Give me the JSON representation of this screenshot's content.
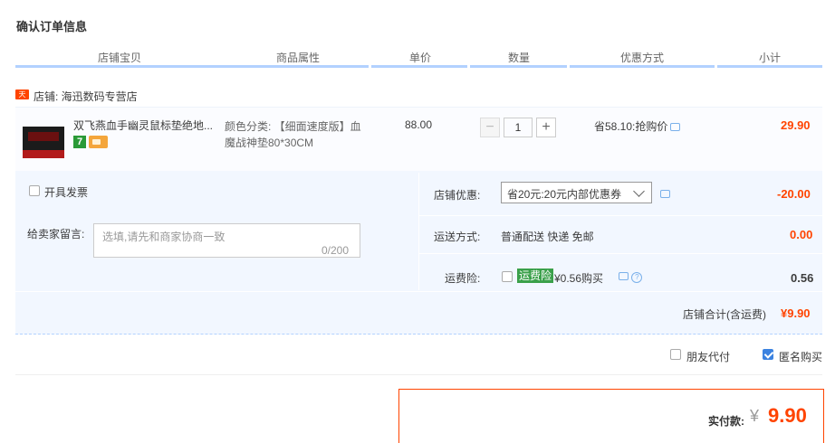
{
  "page_title": "确认订单信息",
  "columns": [
    "店铺宝贝",
    "商品属性",
    "单价",
    "数量",
    "优惠方式",
    "小计"
  ],
  "shop": {
    "tag": "天猫",
    "label": "店铺: 海迅数码专营店"
  },
  "item": {
    "name": "双飞燕血手幽灵鼠标垫绝地...",
    "badge_num": "7",
    "attr_line1": "颜色分类: 【细面速度版】血",
    "attr_line2": "魔战神垫80*30CM",
    "price": "88.00",
    "qty_minus": "−",
    "quantity": "1",
    "qty_plus": "+",
    "promo": "省58.10:抢购价",
    "subtotal": "29.90"
  },
  "invoice_label": "开具发票",
  "message": {
    "label": "给卖家留言:",
    "placeholder": "选填,请先和商家协商一致",
    "count": "0/200"
  },
  "coupon": {
    "label": "店铺优惠:",
    "selected": "省20元:20元内部优惠券",
    "amount": "-20.00"
  },
  "shipping": {
    "label": "运送方式:",
    "method": "普通配送 快递 免邮",
    "amount": "0.00"
  },
  "insurance": {
    "label": "运费险:",
    "tag": "运费险",
    "text": "¥0.56购买",
    "help": "?",
    "amount": "0.56"
  },
  "shop_total": {
    "label": "店铺合计(含运费)",
    "amount": "¥9.90"
  },
  "bottom_options": {
    "friend_pay": "朋友代付",
    "anonymous": "匿名购买"
  },
  "grand_total": {
    "label": "实付款:",
    "currency": "¥",
    "amount": "9.90"
  },
  "colors": {
    "accent": "#ff4400",
    "header_line": "#b2d1ff",
    "panel_bg": "#f2f7ff",
    "check": "#3b82e0"
  }
}
